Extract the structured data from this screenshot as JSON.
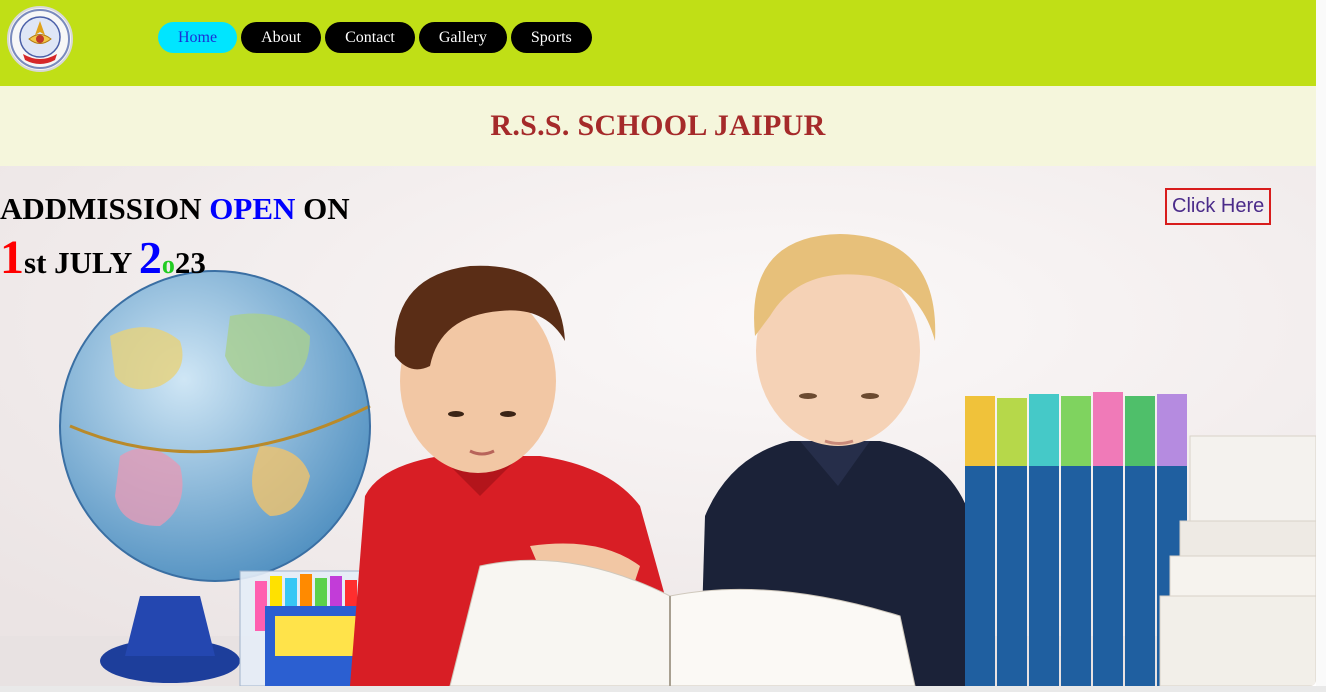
{
  "header": {
    "logo_alt": "School emblem",
    "nav": [
      {
        "label": "Home",
        "active": true
      },
      {
        "label": "About",
        "active": false
      },
      {
        "label": "Contact",
        "active": false
      },
      {
        "label": "Gallery",
        "active": false
      },
      {
        "label": "Sports",
        "active": false
      }
    ],
    "bar_color": "#c0df16"
  },
  "title": "R.S.S. SCHOOL JAIPUR",
  "hero": {
    "admission_prefix": "ADDMISSION ",
    "admission_highlight": "OPEN",
    "admission_suffix": " ON",
    "date_day": "1",
    "date_rest": "st JULY ",
    "year_2": "2",
    "year_o": "o",
    "year_23": "23",
    "cta_label": "Click Here"
  },
  "colors": {
    "title": "#a52a2a",
    "nav_active_bg": "#00e5ff",
    "nav_bg": "#000000",
    "highlight_blue": "#0000ff",
    "highlight_red": "#ff0000",
    "highlight_green": "#22cc22",
    "cta_border": "#d81c1c"
  }
}
